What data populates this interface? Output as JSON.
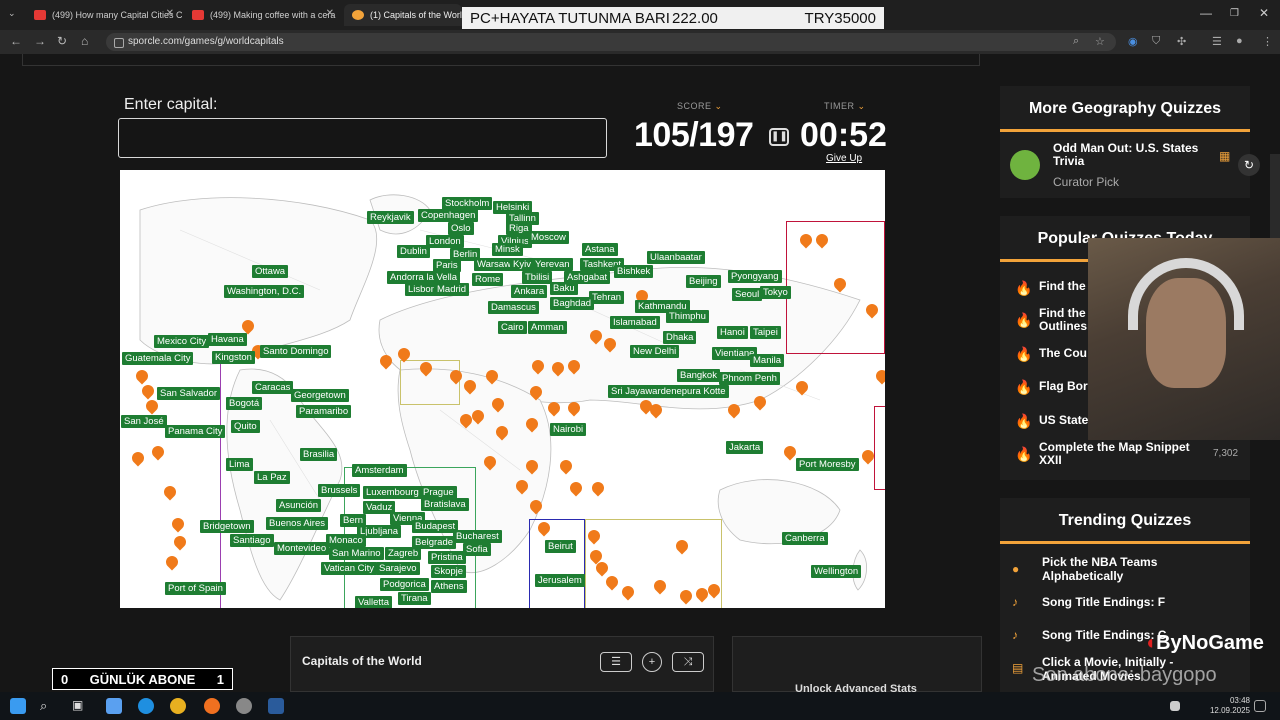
{
  "browser": {
    "tabs": [
      {
        "title": "(499) How many Capital Cities C"
      },
      {
        "title": "(499) Making coffee with a cera"
      },
      {
        "title": "(1) Capitals of the World M"
      }
    ],
    "url": "sporcle.com/games/g/worldcapitals",
    "overlay_left": "PC+HAYATA TUTUNMA BARI",
    "overlay_mid": "222.00",
    "overlay_right": "TRY35000"
  },
  "quiz": {
    "enter_label": "Enter capital:",
    "answer_value": "",
    "score_label": "SCORE",
    "timer_label": "TIMER",
    "score": "105/197",
    "timer": "00:52",
    "give_up": "Give Up",
    "quiz_name": "Capitals of the World",
    "unlock": "Unlock Advanced Stats"
  },
  "map_labels": [
    "Stockholm",
    "Helsinki",
    "Tallinn",
    "Reykjavik",
    "Copenhagen",
    "Oslo",
    "Riga",
    "Vilnius",
    "Minsk",
    "Moscow",
    "Dublin",
    "London",
    "Berlin",
    "Warsaw",
    "Kyiv",
    "Yerevan",
    "Astana",
    "Tashkent",
    "Ulaanbaatar",
    "Paris",
    "Tbilisi",
    "Ashgabat",
    "Bishkek",
    "Andorra la Vella",
    "Lisbon",
    "Madrid",
    "Rome",
    "Baku",
    "Ankara",
    "Beijing",
    "Pyongyang",
    "Ottawa",
    "Seoul",
    "Tokyo",
    "Washington, D.C.",
    "Tehran",
    "Damascus",
    "Baghdad",
    "Kathmandu",
    "Thimphu",
    "Islamabad",
    "Cairo",
    "Amman",
    "Dhaka",
    "Hanoi",
    "Taipei",
    "Mexico City",
    "Havana",
    "Santo Domingo",
    "Kingston",
    "New Delhi",
    "Vientiane",
    "Guatemala City",
    "Manila",
    "Bangkok",
    "Phnom Penh",
    "Caracas",
    "San Salvador",
    "Georgetown",
    "Paramaribo",
    "Sri Jayawardenepura Kotte",
    "Bogotá",
    "San José",
    "Panama City",
    "Quito",
    "Nairobi",
    "Jakarta",
    "Brasilia",
    "Lima",
    "Port Moresby",
    "La Paz",
    "Amsterdam",
    "Brussels",
    "Luxembourg",
    "Prague",
    "Bratislava",
    "Asunción",
    "Vaduz",
    "Bern",
    "Vienna",
    "Buenos Aires",
    "Budapest",
    "Bridgetown",
    "Ljubljana",
    "Santiago",
    "Monaco",
    "Bucharest",
    "Montevideo",
    "Belgrade",
    "San Marino",
    "Zagreb",
    "Sofia",
    "Pristina",
    "Vatican City",
    "Sarajevo",
    "Skopje",
    "Podgorica",
    "Athens",
    "Port of Spain",
    "Tirana",
    "Valletta",
    "Beirut",
    "Canberra",
    "Jerusalem",
    "Wellington"
  ],
  "sidebar": {
    "more_head": "More Geography Quizzes",
    "more_item_title": "Odd Man Out: U.S. States Trivia",
    "more_item_sub": "Curator Pick",
    "popular_head": "Popular Quizzes Today",
    "popular": [
      "Find the",
      "Find the Outlines",
      "The Cou",
      "Flag Bor",
      "US State",
      "Complete the Map Snippet XXII"
    ],
    "popular_count": "7,302",
    "trending_head": "Trending Quizzes",
    "trending": [
      "Pick the NBA Teams Alphabetically",
      "Song Title Endings: F",
      "Song Title Endings: C",
      "Click a Movie, Initially - Animated Movies"
    ]
  },
  "stream": {
    "counter_left": "0",
    "counter_label": "GÜNLÜK ABONE",
    "counter_right": "1",
    "watermark_brand": "ByNoGame",
    "watermark_sub": "Son abone: baygopo"
  },
  "taskbar": {
    "time": "03:48",
    "date": "12.09.2025"
  }
}
